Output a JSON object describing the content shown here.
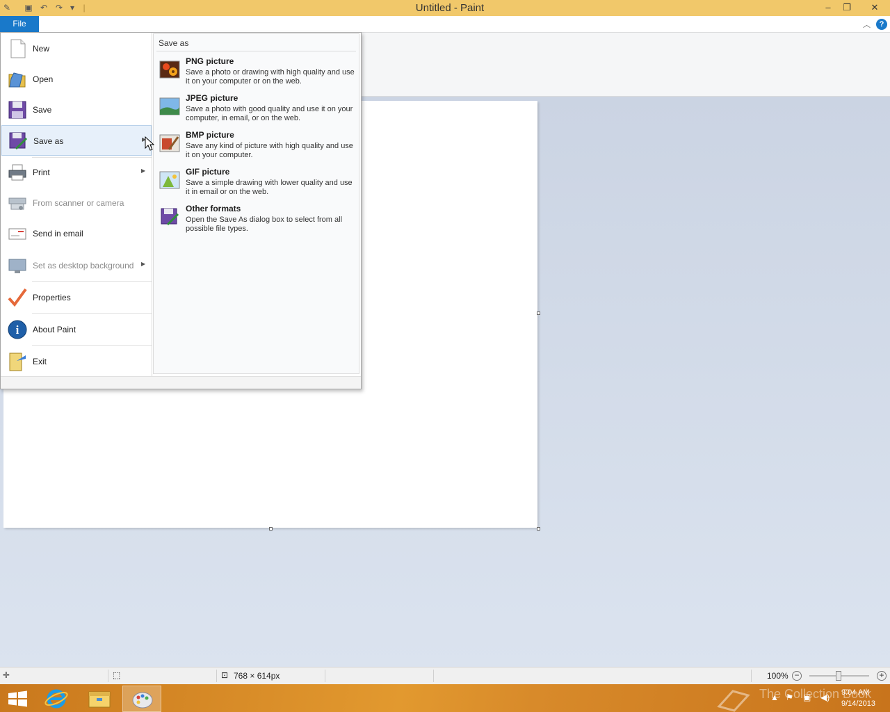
{
  "window": {
    "title": "Untitled - Paint",
    "controls": {
      "minimize": "–",
      "maximize": "❐",
      "close": "✕"
    }
  },
  "ribbon": {
    "file_tab": "File",
    "help": "?"
  },
  "file_menu": {
    "items": [
      {
        "label": "New",
        "icon": "new-document-icon",
        "enabled": true,
        "submenu": false
      },
      {
        "label": "Open",
        "icon": "open-folder-icon",
        "enabled": true,
        "submenu": false
      },
      {
        "label": "Save",
        "icon": "floppy-disk-icon",
        "enabled": true,
        "submenu": false
      },
      {
        "label": "Save as",
        "icon": "save-as-icon",
        "enabled": true,
        "submenu": true,
        "selected": true
      },
      {
        "label": "Print",
        "icon": "printer-icon",
        "enabled": true,
        "submenu": true
      },
      {
        "label": "From scanner or camera",
        "icon": "scanner-icon",
        "enabled": false,
        "submenu": false
      },
      {
        "label": "Send in email",
        "icon": "email-icon",
        "enabled": true,
        "submenu": false
      },
      {
        "label": "Set as desktop background",
        "icon": "desktop-background-icon",
        "enabled": false,
        "submenu": true
      },
      {
        "label": "Properties",
        "icon": "checkmark-icon",
        "enabled": true,
        "submenu": false
      },
      {
        "label": "About Paint",
        "icon": "info-icon",
        "enabled": true,
        "submenu": false
      },
      {
        "label": "Exit",
        "icon": "exit-icon",
        "enabled": true,
        "submenu": false
      }
    ]
  },
  "save_as": {
    "title": "Save as",
    "options": [
      {
        "title": "PNG picture",
        "description": "Save a photo or drawing with high quality and use it on your computer or on the web.",
        "icon": "png-picture-icon"
      },
      {
        "title": "JPEG picture",
        "description": "Save a photo with good quality and use it on your computer, in email, or on the web.",
        "icon": "jpeg-picture-icon"
      },
      {
        "title": "BMP picture",
        "description": "Save any kind of picture with high quality and use it on your computer.",
        "icon": "bmp-picture-icon"
      },
      {
        "title": "GIF picture",
        "description": "Save a simple drawing with lower quality and use it in email or on the web.",
        "icon": "gif-picture-icon"
      },
      {
        "title": "Other formats",
        "description": "Open the Save As dialog box to select from all possible file types.",
        "icon": "other-formats-icon"
      }
    ]
  },
  "status": {
    "canvas_size": "768 × 614px",
    "zoom": "100%"
  },
  "taskbar": {
    "time": "9:04 AM",
    "date": "9/14/2013",
    "watermark": "The Collection Book"
  }
}
